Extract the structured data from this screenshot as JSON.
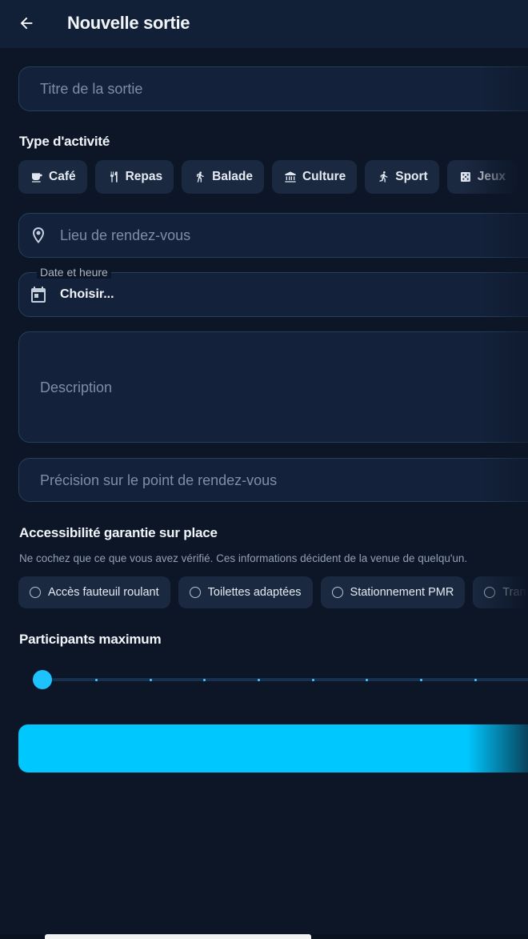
{
  "header": {
    "title": "Nouvelle sortie"
  },
  "form": {
    "title_placeholder": "Titre de la sortie",
    "activity_section_title": "Type d'activité",
    "activities": [
      {
        "label": "Café",
        "icon": "coffee-icon"
      },
      {
        "label": "Repas",
        "icon": "restaurant-icon"
      },
      {
        "label": "Balade",
        "icon": "walk-icon"
      },
      {
        "label": "Culture",
        "icon": "museum-icon"
      },
      {
        "label": "Sport",
        "icon": "run-icon"
      },
      {
        "label": "Jeux",
        "icon": "dice-icon"
      }
    ],
    "location_placeholder": "Lieu de rendez-vous",
    "datetime_label": "Date et heure",
    "datetime_value": "Choisir...",
    "description_placeholder": "Description",
    "meeting_point_placeholder": "Précision sur le point de rendez-vous",
    "accessibility_title": "Accessibilité garantie sur place",
    "accessibility_helper": "Ne cochez que ce que vous avez vérifié. Ces informations décident de la venue de quelqu'un.",
    "accessibility_options": [
      {
        "label": "Accès fauteuil roulant",
        "checked": false
      },
      {
        "label": "Toilettes adaptées",
        "checked": false
      },
      {
        "label": "Stationnement PMR",
        "checked": false
      },
      {
        "label": "Trans",
        "checked": false
      }
    ],
    "participants_title": "Participants maximum",
    "participants_value_fraction": 0.0
  },
  "colors": {
    "background": "#0c1627",
    "accent": "#00c8ff",
    "field_bg": "#13213a"
  }
}
